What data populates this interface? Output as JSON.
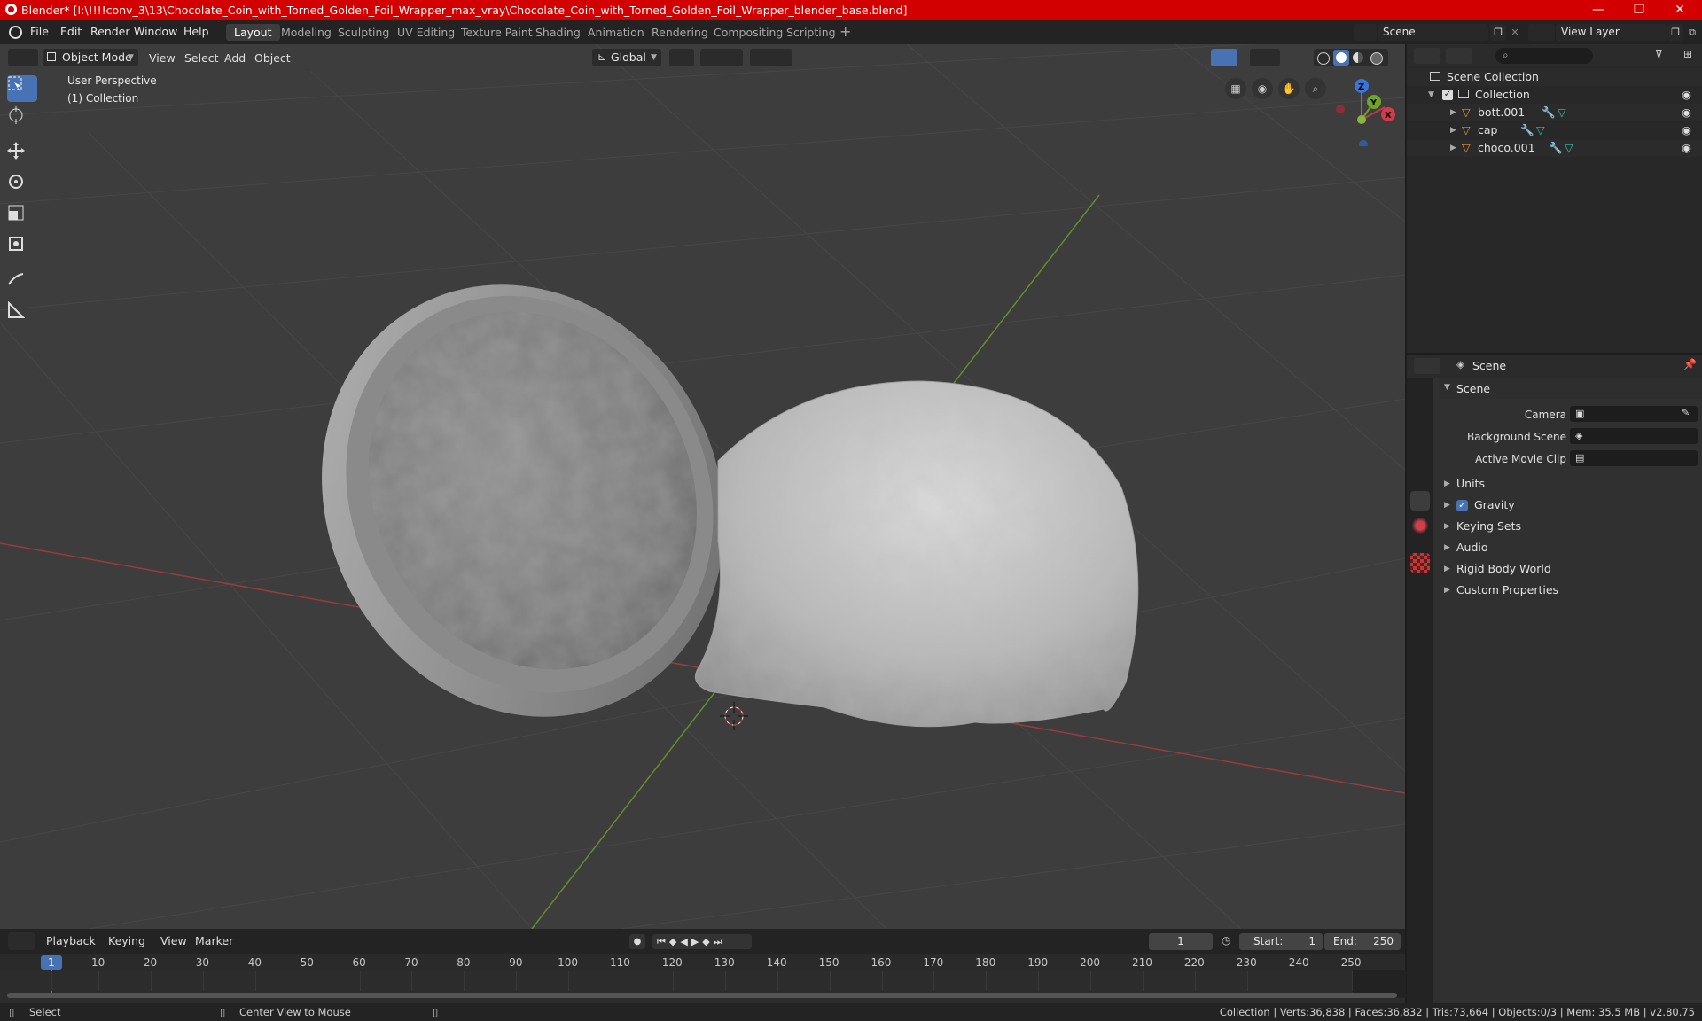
{
  "titlebar": {
    "title": "Blender* [I:\\!!!!conv_3\\13\\Chocolate_Coin_with_Torned_Golden_Foil_Wrapper_max_vray\\Chocolate_Coin_with_Torned_Golden_Foil_Wrapper_blender_base.blend]",
    "minimize": "—",
    "maximize": "❐",
    "close": "✕"
  },
  "menu": {
    "items": [
      "File",
      "Edit",
      "Render",
      "Window",
      "Help"
    ]
  },
  "workspaces": {
    "tabs": [
      "Layout",
      "Modeling",
      "Sculpting",
      "UV Editing",
      "Texture Paint",
      "Shading",
      "Animation",
      "Rendering",
      "Compositing",
      "Scripting"
    ],
    "add": "+"
  },
  "scene_selector": {
    "value": "Scene"
  },
  "view_layer_selector": {
    "value": "View Layer"
  },
  "viewport": {
    "mode": "Object Mode",
    "menus": [
      "View",
      "Select",
      "Add",
      "Object"
    ],
    "orientation": "Global",
    "perspective_label": "User Perspective",
    "collection_label": "(1) Collection",
    "gizmo": {
      "x": "X",
      "y": "Y",
      "z": "Z"
    }
  },
  "outliner": {
    "root": "Scene Collection",
    "collection": "Collection",
    "objects": [
      "bott.001",
      "cap",
      "choco.001"
    ]
  },
  "properties": {
    "header": "Scene",
    "panel": "Scene",
    "fields": {
      "camera": "Camera",
      "background_scene": "Background Scene",
      "active_movie_clip": "Active Movie Clip"
    },
    "subpanels": [
      "Units",
      "Gravity",
      "Keying Sets",
      "Audio",
      "Rigid Body World",
      "Custom Properties"
    ],
    "gravity_checked": true
  },
  "timeline": {
    "menus": [
      "Playback",
      "Keying",
      "View",
      "Marker"
    ],
    "current_frame": "1",
    "start_label": "Start:",
    "start": "1",
    "end_label": "End:",
    "end": "250",
    "ticks": [
      "1",
      "10",
      "20",
      "30",
      "40",
      "50",
      "60",
      "70",
      "80",
      "90",
      "100",
      "110",
      "120",
      "130",
      "140",
      "150",
      "160",
      "170",
      "180",
      "190",
      "200",
      "210",
      "220",
      "230",
      "240",
      "250"
    ]
  },
  "statusbar": {
    "select": "Select",
    "center_view": "Center View to Mouse",
    "stats": "Collection | Verts:36,838 | Faces:36,832 | Tris:73,664 | Objects:0/3 | Mem: 35.5 MB | v2.80.75"
  },
  "colors": {
    "titlebar": "#d30000",
    "accent": "#4772b3",
    "viewport_bg": "#3d3d3d",
    "axis_x": "#9a3b3b",
    "axis_y": "#6a8a2a",
    "object_icon": "#e8913a",
    "modifier_icon": "#6aa3ff",
    "mesh_icon": "#35c3a5"
  }
}
